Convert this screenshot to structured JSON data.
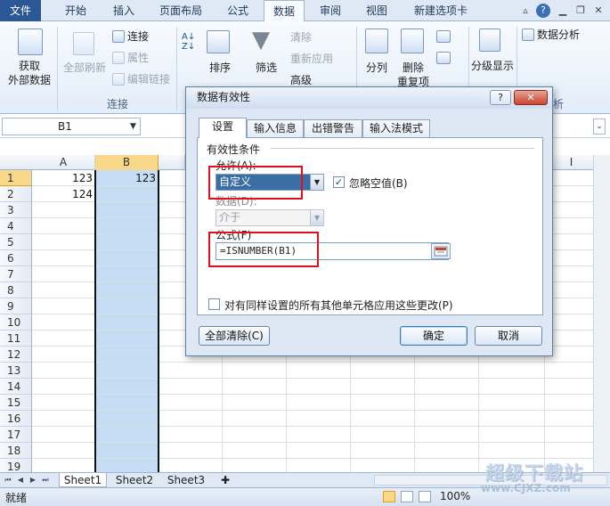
{
  "ribbon_tabs": [
    "文件",
    "开始",
    "插入",
    "页面布局",
    "公式",
    "数据",
    "审阅",
    "视图",
    "新建选项卡"
  ],
  "active_ribbon_tab": "数据",
  "ribbon": {
    "get_external_data": "获取\n外部数据",
    "refresh_all": "全部刷新",
    "connections": "连接",
    "properties": "属性",
    "edit_links": "编辑链接",
    "group_connections": "连接",
    "sort": "排序",
    "filter": "筛选",
    "clear": "清除",
    "reapply": "重新应用",
    "advanced": "高级",
    "text_to_columns": "分列",
    "remove_duplicates": "删除\n重复项",
    "outline": "分级显示",
    "data_analysis": "数据分析",
    "group_analysis_tail": "析"
  },
  "formula_bar": {
    "name_box": "B1"
  },
  "columns": [
    "A",
    "B",
    "I"
  ],
  "rows": [
    "1",
    "2",
    "3",
    "4",
    "5",
    "6",
    "7",
    "8",
    "9",
    "10",
    "11",
    "12",
    "13",
    "14",
    "15",
    "16",
    "17",
    "18",
    "19"
  ],
  "cells": {
    "A1": "123",
    "B1": "123",
    "A2": "124"
  },
  "sheets": [
    "Sheet1",
    "Sheet2",
    "Sheet3"
  ],
  "active_sheet": "Sheet1",
  "status": {
    "ready": "就绪",
    "zoom": "100%"
  },
  "dialog": {
    "title": "数据有效性",
    "help_button": "?",
    "close_button": "✕",
    "tabs": [
      "设置",
      "输入信息",
      "出错警告",
      "输入法模式"
    ],
    "active_tab": "设置",
    "section_title": "有效性条件",
    "allow_label": "允许(A):",
    "allow_value": "自定义",
    "ignore_blank_label": "忽略空值(B)",
    "ignore_blank_checked": true,
    "data_label": "数据(D):",
    "data_value": "介于",
    "formula_label": "公式(F)",
    "formula_value": "=ISNUMBER(B1)",
    "apply_all_label": "对有同样设置的所有其他单元格应用这些更改(P)",
    "apply_all_checked": false,
    "clear_all_button": "全部清除(C)",
    "ok_button": "确定",
    "cancel_button": "取消"
  },
  "watermark": {
    "line1": "超级下载站",
    "line2": "www.CJXZ.com"
  },
  "colors": {
    "accent": "#2b5797",
    "highlight_red": "#e0111d",
    "selected_column": "#c5dcf4"
  }
}
